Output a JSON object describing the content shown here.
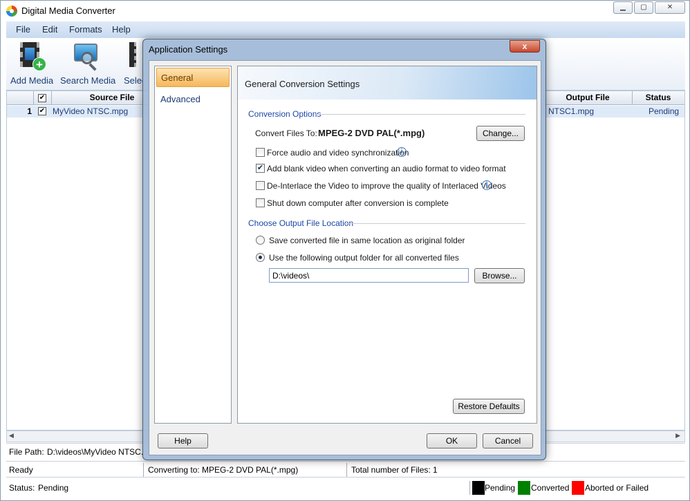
{
  "window": {
    "title": "Digital Media Converter",
    "minimize": "▁",
    "maximize": "▢",
    "close": "✕"
  },
  "menu": [
    "File",
    "Edit",
    "Formats",
    "Help"
  ],
  "toolbar": {
    "add_media": "Add Media",
    "search_media": "Search Media",
    "select": "Selec"
  },
  "grid": {
    "columns": {
      "source": "Source File",
      "output": "Output File",
      "status": "Status"
    },
    "rows": [
      {
        "num": "1",
        "source": "MyVideo NTSC.mpg",
        "output": "NTSC1.mpg",
        "status": "Pending"
      }
    ]
  },
  "footer": {
    "file_path_label": "File Path:",
    "file_path_value": "D:\\videos\\MyVideo NTSC.",
    "ready": "Ready",
    "converting_to": "Converting to: MPEG-2 DVD PAL(*.mpg)",
    "total_files": "Total number of Files: 1",
    "status_label": "Status:",
    "status_value": "Pending",
    "legend": [
      {
        "label": "Pending",
        "color": "#000000"
      },
      {
        "label": "Converted",
        "color": "#008000"
      },
      {
        "label": "Aborted or Failed",
        "color": "#ff0000"
      }
    ]
  },
  "dialog": {
    "title": "Application Settings",
    "close": "x",
    "nav": [
      "General",
      "Advanced"
    ],
    "panel_title": "General Conversion Settings",
    "conversion_options": "Conversion Options",
    "convert_files_to_label": "Convert Files To:",
    "convert_files_to_value": "MPEG-2 DVD PAL(*.mpg)",
    "change_button": "Change...",
    "options": [
      {
        "label": "Force audio and video synchronization",
        "checked": false,
        "info": true
      },
      {
        "label": "Add blank video when converting an audio format to video format",
        "checked": true,
        "info": false
      },
      {
        "label": "De-Interlace the Video to improve the quality of Interlaced Videos",
        "checked": false,
        "info": true
      },
      {
        "label": "Shut down computer after conversion is complete",
        "checked": false,
        "info": false
      }
    ],
    "output_location": "Choose Output File Location",
    "radio_same": "Save converted file in same location as original folder",
    "radio_following": "Use the following output folder for all converted files",
    "output_folder": "D:\\videos\\",
    "browse_button": "Browse...",
    "restore_defaults": "Restore Defaults",
    "help": "Help",
    "ok": "OK",
    "cancel": "Cancel"
  }
}
